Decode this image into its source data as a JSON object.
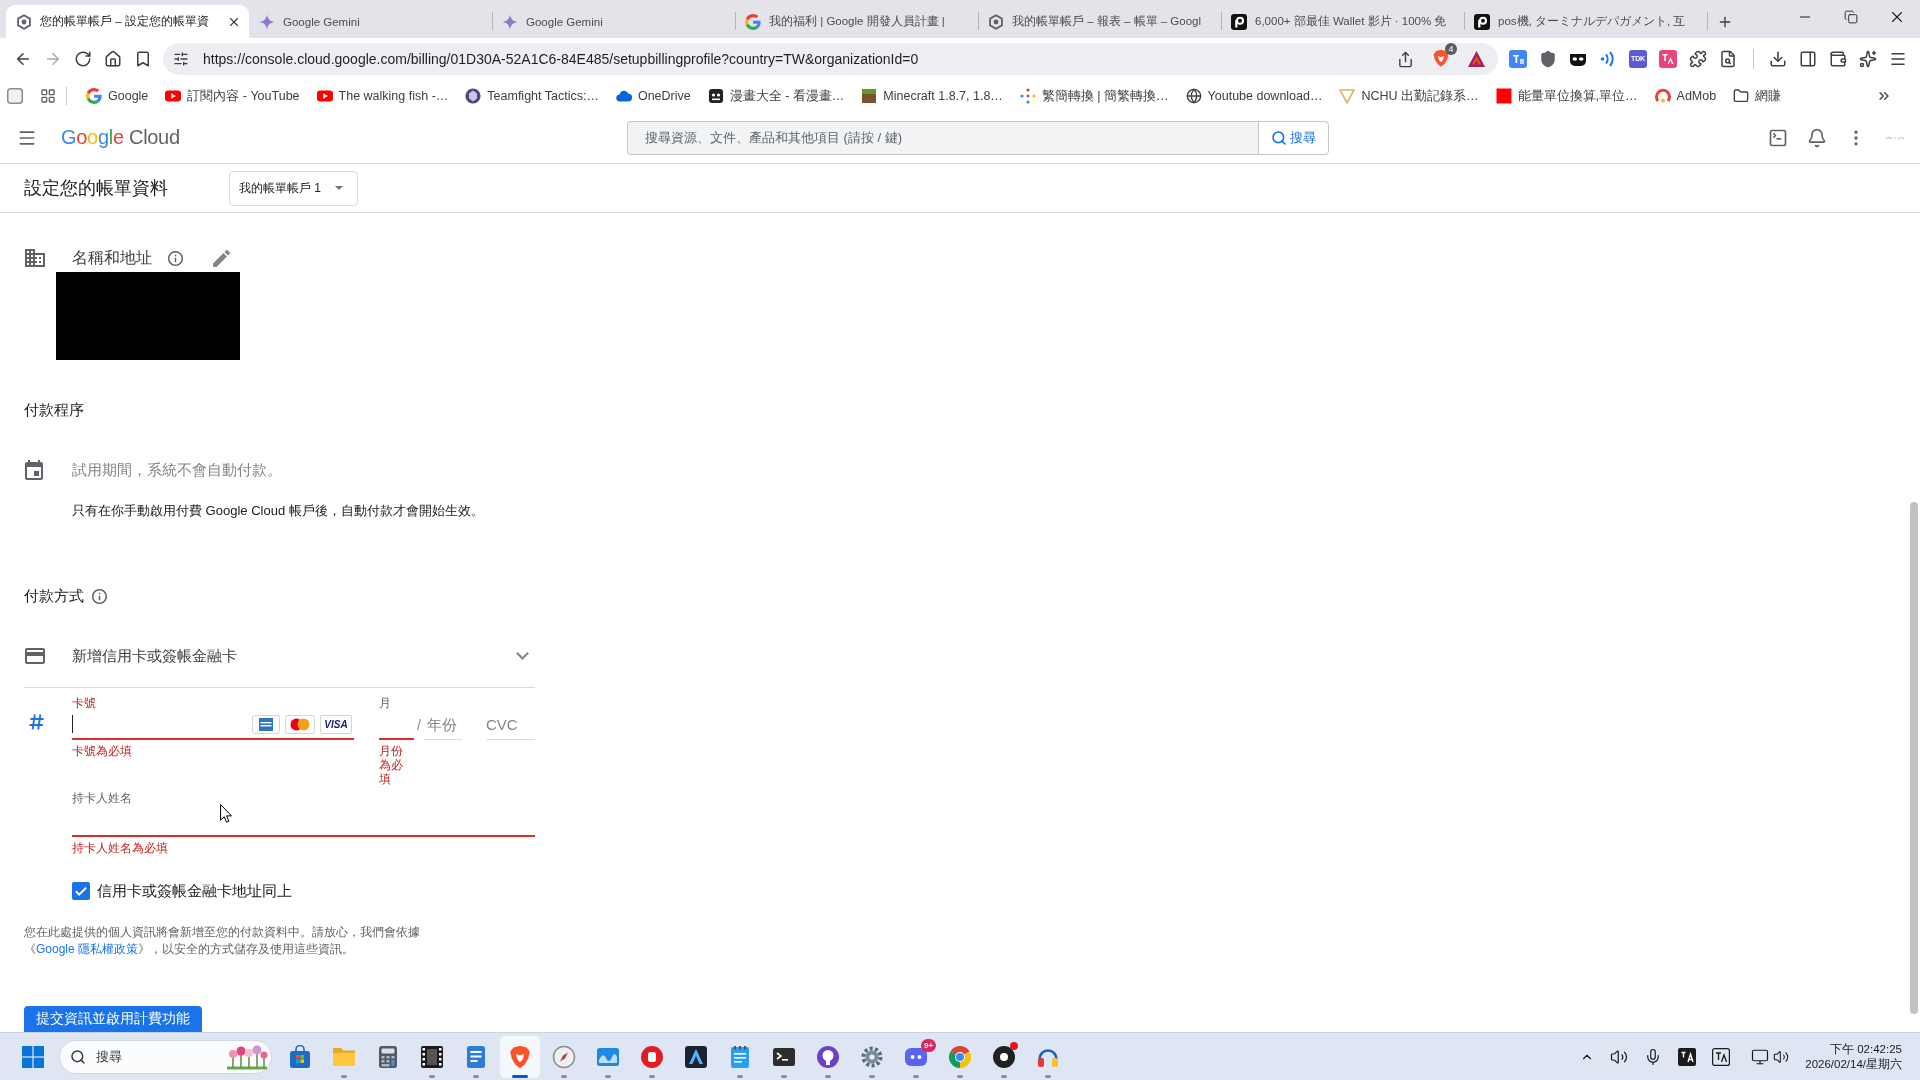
{
  "browser": {
    "tabs": [
      {
        "title": "您的帳單帳戶 – 設定您的帳單資",
        "selected": true
      },
      {
        "title": "Google Gemini",
        "selected": false
      },
      {
        "title": "Google Gemini",
        "selected": false
      },
      {
        "title": "我的福利 | Google 開發人員計畫 |",
        "selected": false
      },
      {
        "title": "我的帳單帳戶 – 報表 – 帳單 – Googl",
        "selected": false
      },
      {
        "title": "6,000+ 部最佳 Wallet 影片 · 100% 免",
        "selected": false
      },
      {
        "title": "pos機, ターミナルデパガメント, 互",
        "selected": false
      }
    ],
    "url": "https://console.cloud.google.com/billing/01D30A-52A1C6-84E485/setupbillingprofile?country=TW&organizationId=0",
    "shield_count": "4",
    "extension_label": "TDK",
    "bookmarks": [
      "Google",
      "訂閱內容 - YouTube",
      "The walking fish -…",
      "Teamfight Tactics:…",
      "OneDrive",
      "漫畫大全 - 看漫畫…",
      "Minecraft 1.8.7, 1.8…",
      "繁簡轉換 | 簡繁轉換…",
      "Youtube download…",
      "NCHU 出勤記錄系…",
      "能量單位換算,單位…",
      "AdMob",
      "網賺"
    ]
  },
  "console": {
    "logo": {
      "brand": "Google",
      "product": "Cloud"
    },
    "search": {
      "placeholder": "搜尋資源、文件、產品和其他項目 (請按 / 鍵)",
      "button": "搜尋"
    },
    "page_title": "設定您的帳單資料",
    "account_selector": "我的帳單帳戶 1",
    "name_address": {
      "title": "名稱和地址"
    },
    "payment_process": {
      "title": "付款程序",
      "notice": "試用期間，系統不會自動付款。",
      "detail": "只有在你手動啟用付費 Google Cloud 帳戶後，自動付款才會開始生效。"
    },
    "payment_method": {
      "title": "付款方式",
      "option": "新增信用卡或簽帳金融卡"
    },
    "card_form": {
      "card_number": {
        "label": "卡號",
        "focused": true,
        "invalid": true,
        "error": "卡號為必填",
        "brands": [
          {
            "kind": "amex"
          },
          {
            "kind": "mastercard"
          },
          {
            "kind": "visa",
            "label": "VISA"
          }
        ]
      },
      "month": {
        "label": "月",
        "focused": false,
        "invalid": true,
        "error": "月份為必填"
      },
      "year": {
        "separator": "/",
        "placeholder": "年份",
        "invalid": false
      },
      "cvc": {
        "placeholder": "CVC",
        "invalid": false
      },
      "cardholder": {
        "label": "持卡人姓名",
        "focused": false,
        "invalid": true,
        "error": "持卡人姓名為必填"
      },
      "same_address": {
        "label": "信用卡或簽帳金融卡地址同上",
        "checked": true
      }
    },
    "privacy": {
      "before": "您在此處提供的個人資訊將會新增至您的付款資料中。請放心，我們會依據《",
      "link": "Google 隱私權政策",
      "after": "》，以安全的方式儲存及使用這些資訊。"
    },
    "submit": "提交資訊並啟用計費功能"
  },
  "taskbar": {
    "search": "搜尋",
    "apps": [
      {
        "running": false,
        "selected": false,
        "alert": false
      },
      {
        "running": true,
        "selected": false,
        "alert": false
      },
      {
        "running": false,
        "selected": false,
        "alert": false
      },
      {
        "running": true,
        "selected": false,
        "alert": false
      },
      {
        "running": true,
        "selected": false,
        "alert": false
      },
      {
        "running": true,
        "selected": true,
        "alert": false
      },
      {
        "running": true,
        "selected": false,
        "alert": false
      },
      {
        "running": true,
        "selected": false,
        "alert": false
      },
      {
        "running": true,
        "selected": false,
        "alert": false
      },
      {
        "running": false,
        "selected": false,
        "alert": false
      },
      {
        "running": true,
        "selected": false,
        "alert": false
      },
      {
        "running": true,
        "selected": false,
        "alert": false
      },
      {
        "running": true,
        "selected": false,
        "alert": false
      },
      {
        "running": true,
        "selected": false,
        "alert": false
      },
      {
        "running": true,
        "selected": false,
        "alert": false,
        "badge": "9+"
      },
      {
        "running": true,
        "selected": false,
        "alert": false
      },
      {
        "running": true,
        "selected": false,
        "alert": true
      },
      {
        "running": true,
        "selected": false,
        "alert": false
      }
    ],
    "clock": {
      "time": "下午 02:42:25",
      "date": "2026/02/14/星期六"
    }
  }
}
